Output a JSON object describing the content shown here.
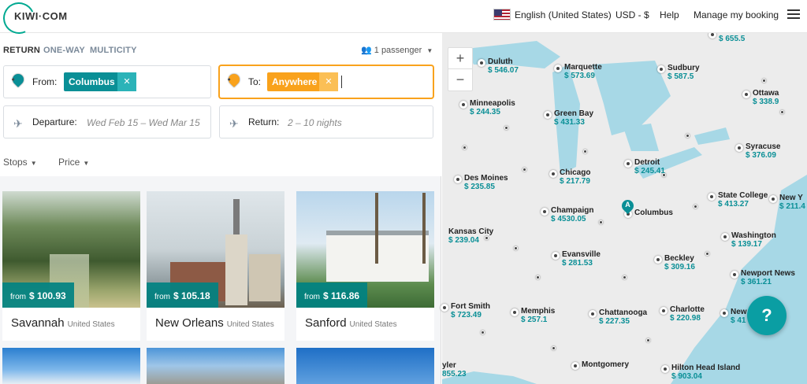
{
  "header": {
    "logo_text": "KIWI·COM",
    "language": "English (United States)",
    "currency": "USD - $",
    "help": "Help",
    "manage": "Manage my booking"
  },
  "trip_types": [
    "RETURN",
    "ONE-WAY",
    "MULTICITY"
  ],
  "passengers": "1 passenger",
  "search": {
    "from_label": "From:",
    "from_value": "Columbus",
    "from_pin": "A",
    "to_label": "To:",
    "to_value": "Anywhere",
    "to_pin": "B",
    "departure_label": "Departure:",
    "departure_value": "Wed Feb 15 – Wed Mar 15",
    "return_label": "Return:",
    "return_value": "2 – 10 nights"
  },
  "filters": [
    "Stops",
    "Price"
  ],
  "cards": [
    {
      "city": "Savannah",
      "country": "United States",
      "from": "from",
      "price": "$ 100.93"
    },
    {
      "city": "New Orleans",
      "country": "United States",
      "from": "from",
      "price": "$ 105.18"
    },
    {
      "city": "Sanford",
      "country": "United States",
      "from": "from",
      "price": "$ 116.86"
    }
  ],
  "map": {
    "origin_pin": "A",
    "origin": "Columbus",
    "markers": [
      {
        "name": "",
        "price": "$ 655.5"
      },
      {
        "name": "Duluth",
        "price": "$ 546.07"
      },
      {
        "name": "Marquette",
        "price": "$ 573.69"
      },
      {
        "name": "Sudbury",
        "price": "$ 587.5"
      },
      {
        "name": "Ottawa",
        "price": "$ 338.9"
      },
      {
        "name": "Minneapolis",
        "price": "$ 244.35"
      },
      {
        "name": "Green Bay",
        "price": "$ 431.33"
      },
      {
        "name": "Syracuse",
        "price": "$ 376.09"
      },
      {
        "name": "Detroit",
        "price": "$ 245.41"
      },
      {
        "name": "Des Moines",
        "price": "$ 235.85"
      },
      {
        "name": "Chicago",
        "price": "$ 217.79"
      },
      {
        "name": "State College",
        "price": "$ 413.27"
      },
      {
        "name": "New Y",
        "price": "$ 211.4"
      },
      {
        "name": "Champaign",
        "price": "$ 4530.05"
      },
      {
        "name": "Kansas City",
        "price": "$ 239.04"
      },
      {
        "name": "Washington",
        "price": "$ 139.17"
      },
      {
        "name": "Evansville",
        "price": "$ 281.53"
      },
      {
        "name": "Beckley",
        "price": "$ 309.16"
      },
      {
        "name": "Newport News",
        "price": "$ 361.21"
      },
      {
        "name": "Fort Smith",
        "price": "$ 723.49"
      },
      {
        "name": "Memphis",
        "price": "$ 257.1"
      },
      {
        "name": "Chattanooga",
        "price": "$ 227.35"
      },
      {
        "name": "Charlotte",
        "price": "$ 220.98"
      },
      {
        "name": "New",
        "price": "$ 41"
      },
      {
        "name": "yler",
        "price": "855.23"
      },
      {
        "name": "Montgomery",
        "price": ""
      },
      {
        "name": "Hilton Head Island",
        "price": "$ 903.04"
      }
    ],
    "zoom_in": "+",
    "zoom_out": "−"
  },
  "help_button": "?",
  "icons": [
    "kiwi-logo-icon",
    "us-flag-icon",
    "hamburger-menu-icon",
    "passenger-icon",
    "takeoff-icon",
    "landing-icon",
    "help-icon"
  ],
  "colors": {
    "accent": "#00a991",
    "from_chip": "#0a8f96",
    "to_chip": "#f9a21c",
    "map_teal": "#0a9ea3"
  }
}
